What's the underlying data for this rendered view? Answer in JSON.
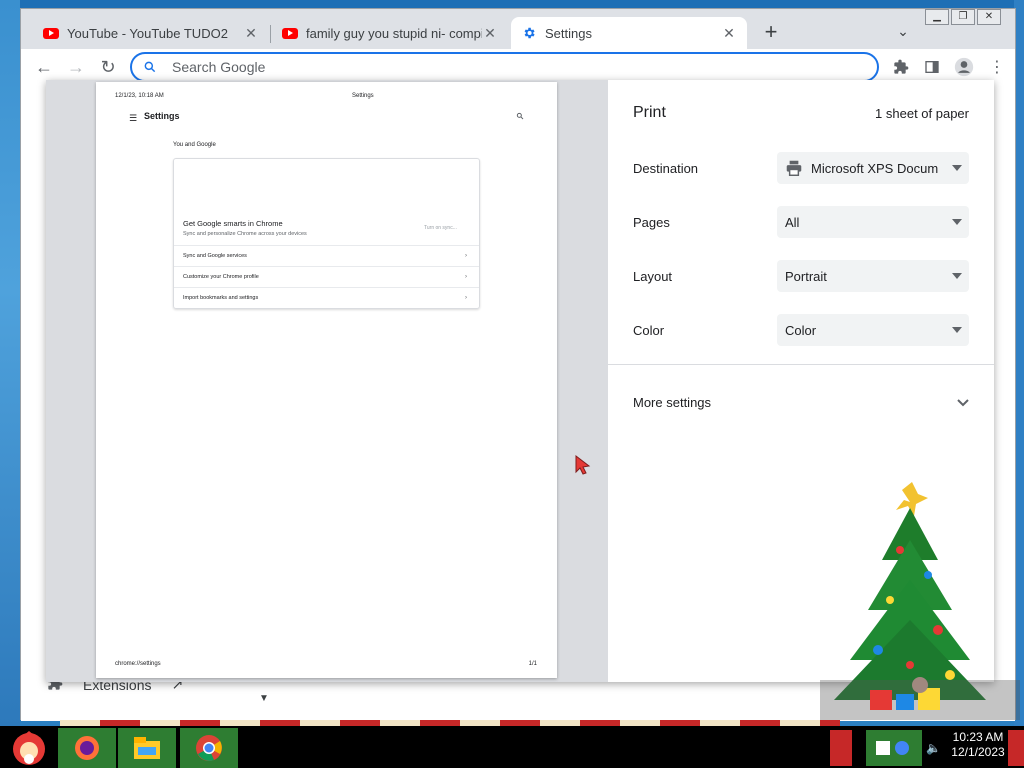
{
  "tabs": [
    {
      "label": "YouTube - YouTube TUDO2",
      "icon": "youtube-icon"
    },
    {
      "label": "family guy you stupid ni- compila",
      "icon": "youtube-icon"
    },
    {
      "label": "Settings",
      "icon": "settings-gear-icon",
      "active": true
    }
  ],
  "omnibox": {
    "placeholder": "Search Google"
  },
  "background_page": {
    "extensions_label": "Extensions"
  },
  "print": {
    "title": "Print",
    "sheets": "1 sheet of paper",
    "fields": [
      {
        "label": "Destination",
        "value": "Microsoft XPS Docum"
      },
      {
        "label": "Pages",
        "value": "All"
      },
      {
        "label": "Layout",
        "value": "Portrait"
      },
      {
        "label": "Color",
        "value": "Color"
      }
    ],
    "more_settings": "More settings"
  },
  "preview": {
    "header_date": "12/1/23, 10:18 AM",
    "header_title": "Settings",
    "page_title": "Settings",
    "section": "You and Google",
    "card_title": "Get Google smarts in Chrome",
    "card_subtitle": "Sync and personalize Chrome across your devices",
    "card_button": "Turn on sync...",
    "rows": [
      "Sync and Google services",
      "Customize your Chrome profile",
      "Import bookmarks and settings"
    ],
    "footer_url": "chrome://settings",
    "footer_page": "1/1"
  },
  "taskbar": {
    "time": "10:23 AM",
    "date": "12/1/2023"
  },
  "colors": {
    "accent": "#1a73e8",
    "taskbar": "#000000",
    "desktop": "#2a7fc1"
  }
}
